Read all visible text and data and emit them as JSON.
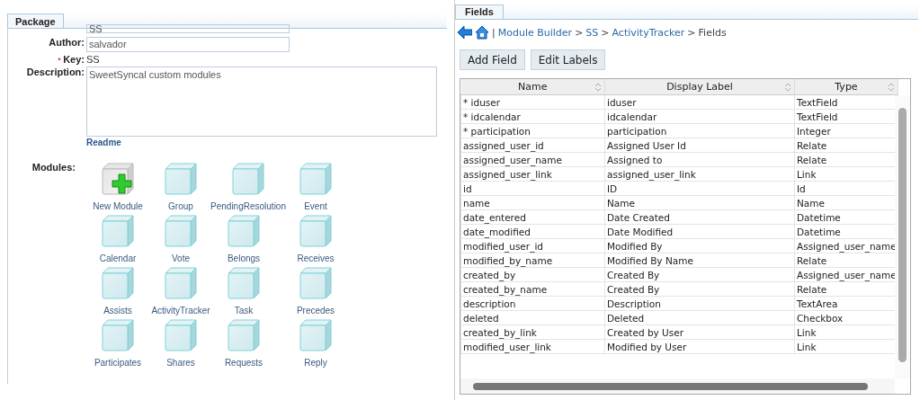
{
  "package_panel": {
    "tab": {
      "label": "Package",
      "selected": true
    },
    "name_field": {
      "value": "SS"
    },
    "author": {
      "label": "Author:",
      "value": "salvador"
    },
    "key": {
      "required_mark": "*",
      "label": "Key:",
      "value": "SS"
    },
    "description": {
      "label": "Description:",
      "value": "SweetSyncal custom modules"
    },
    "readme_link": "Readme",
    "modules_label": "Modules:",
    "modules": [
      {
        "kind": "new",
        "label": "New Module"
      },
      {
        "kind": "module",
        "label": "Group"
      },
      {
        "kind": "module",
        "label": "PendingResolution"
      },
      {
        "kind": "module",
        "label": "Event"
      },
      {
        "kind": "module",
        "label": "Calendar"
      },
      {
        "kind": "module",
        "label": "Vote"
      },
      {
        "kind": "module",
        "label": "Belongs"
      },
      {
        "kind": "module",
        "label": "Receives"
      },
      {
        "kind": "module",
        "label": "Assists"
      },
      {
        "kind": "module",
        "label": "ActivityTracker"
      },
      {
        "kind": "module",
        "label": "Task"
      },
      {
        "kind": "module",
        "label": "Precedes"
      },
      {
        "kind": "module",
        "label": "Participates"
      },
      {
        "kind": "module",
        "label": "Shares"
      },
      {
        "kind": "module",
        "label": "Requests"
      },
      {
        "kind": "module",
        "label": "Reply"
      }
    ]
  },
  "fields_panel": {
    "tab": {
      "label": "Fields",
      "selected": true
    },
    "breadcrumb": {
      "separator": "|",
      "links": [
        "Module Builder",
        "SS",
        "ActivityTracker"
      ],
      "arrow": ">",
      "current": "Fields"
    },
    "buttons": [
      "Add Field",
      "Edit Labels"
    ],
    "table": {
      "columns": [
        "Name",
        "Display Label",
        "Type"
      ],
      "rows": [
        [
          "* iduser",
          "iduser",
          "TextField"
        ],
        [
          "* idcalendar",
          "idcalendar",
          "TextField"
        ],
        [
          "* participation",
          "participation",
          "Integer"
        ],
        [
          "assigned_user_id",
          "Assigned User Id",
          "Relate"
        ],
        [
          "assigned_user_name",
          "Assigned to",
          "Relate"
        ],
        [
          "assigned_user_link",
          "assigned_user_link",
          "Link"
        ],
        [
          "id",
          "ID",
          "Id"
        ],
        [
          "name",
          "Name",
          "Name"
        ],
        [
          "date_entered",
          "Date Created",
          "Datetime"
        ],
        [
          "date_modified",
          "Date Modified",
          "Datetime"
        ],
        [
          "modified_user_id",
          "Modified By",
          "Assigned_user_name"
        ],
        [
          "modified_by_name",
          "Modified By Name",
          "Relate"
        ],
        [
          "created_by",
          "Created By",
          "Assigned_user_name"
        ],
        [
          "created_by_name",
          "Created By",
          "Relate"
        ],
        [
          "description",
          "Description",
          "TextArea"
        ],
        [
          "deleted",
          "Deleted",
          "Checkbox"
        ],
        [
          "created_by_link",
          "Created by User",
          "Link"
        ],
        [
          "modified_user_link",
          "Modified by User",
          "Link"
        ]
      ]
    }
  }
}
